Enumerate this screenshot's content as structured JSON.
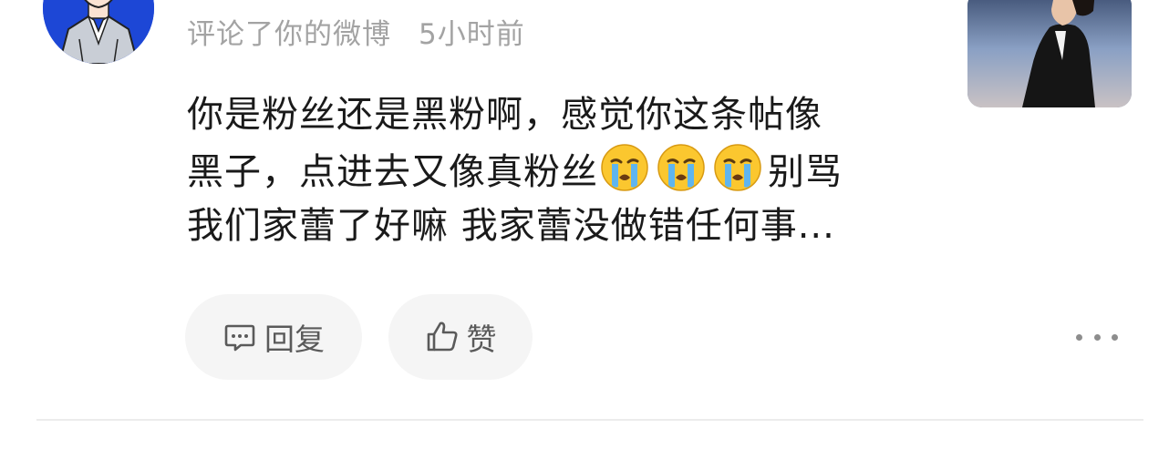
{
  "comment": {
    "meta_action": "评论了你的微博",
    "time": "5小时前",
    "content_lines": [
      "你是粉丝还是黑粉啊，感觉你这条帖像",
      "黑子，点进去又像真粉丝",
      "别骂",
      "我们家蕾了好嘛 我家蕾没做错任何事..."
    ],
    "emoji_names": [
      "crying-face",
      "crying-face",
      "crying-face"
    ]
  },
  "actions": {
    "reply_label": "回复",
    "like_label": "赞"
  },
  "colors": {
    "avatar_bg": "#1d47d6",
    "meta_text": "#a3a3a3",
    "content_text": "#1a1a1a",
    "pill_bg": "#f5f5f5",
    "pill_text": "#5a5a5a"
  }
}
